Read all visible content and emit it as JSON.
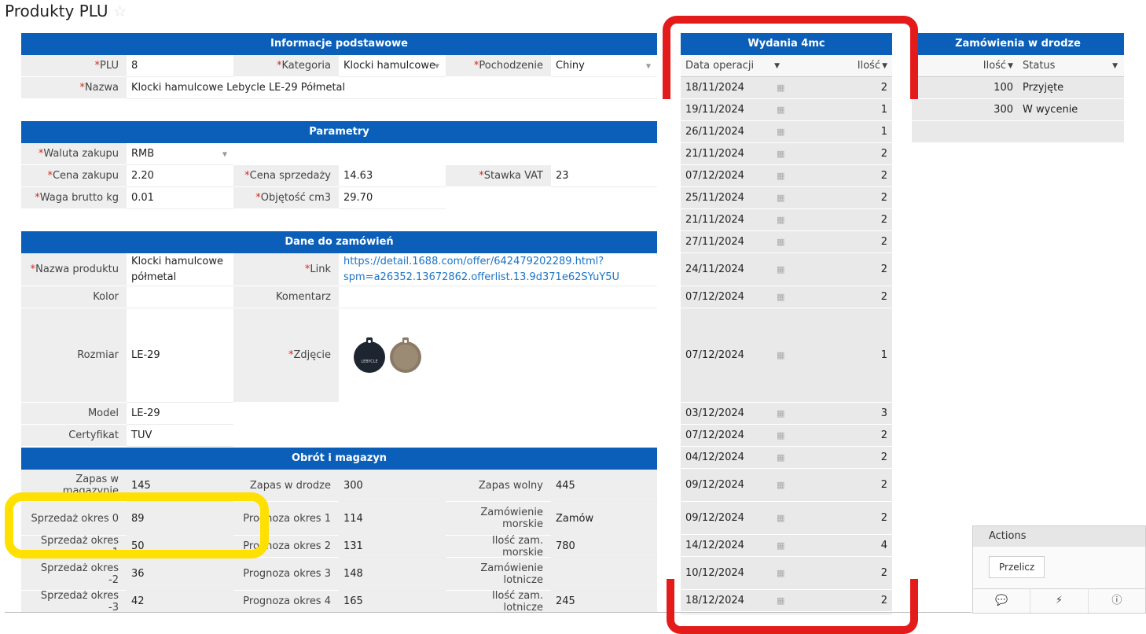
{
  "page": {
    "title": "Produkty PLU",
    "star_icon": "star-icon"
  },
  "info": {
    "header": "Informacje podstawowe",
    "plu_label": "PLU",
    "plu_value": "8",
    "kategoria_label": "Kategoria",
    "kategoria_value": "Klocki hamulcowe",
    "pochodzenie_label": "Pochodzenie",
    "pochodzenie_value": "Chiny",
    "nazwa_label": "Nazwa",
    "nazwa_value": "Klocki hamulcowe Lebycle LE-29 Półmetal"
  },
  "params": {
    "header": "Parametry",
    "waluta_label": "Waluta zakupu",
    "waluta_value": "RMB",
    "cena_zakupu_label": "Cena zakupu",
    "cena_zakupu_value": "2.20",
    "cena_sprzedazy_label": "Cena sprzedaży",
    "cena_sprzedazy_value": "14.63",
    "vat_label": "Stawka VAT",
    "vat_value": "23",
    "waga_label": "Waga brutto kg",
    "waga_value": "0.01",
    "objetosc_label": "Objętość cm3",
    "objetosc_value": "29.70"
  },
  "orders_data": {
    "header": "Dane do zamówień",
    "nazwa_produktu_label": "Nazwa produktu",
    "nazwa_produktu_l1": "Klocki hamulcowe",
    "nazwa_produktu_l2": "półmetal",
    "link_label": "Link",
    "link_l1": "https://detail.1688.com/offer/642479202289.html?",
    "link_l2": "spm=a26352.13672862.offerlist.13.9d371e62SYuY5U",
    "kolor_label": "Kolor",
    "kolor_value": "",
    "komentarz_label": "Komentarz",
    "komentarz_value": "",
    "rozmiar_label": "Rozmiar",
    "rozmiar_value": "LE-29",
    "zdjecie_label": "Zdjęcie",
    "logo_text": "LEBYCLE",
    "model_label": "Model",
    "model_value": "LE-29",
    "certyfikat_label": "Certyfikat",
    "certyfikat_value": "TUV"
  },
  "stock": {
    "header": "Obrót i magazyn",
    "rows": [
      {
        "l1": "Zapas w magazynie",
        "v1": "145",
        "l2": "Zapas w drodze",
        "v2": "300",
        "l3": "Zapas wolny",
        "v3": "445"
      },
      {
        "l1": "Sprzedaż okres 0",
        "v1": "89",
        "l2": "Prognoza okres 1",
        "v2": "114",
        "l3": "Zamówienie morskie",
        "v3": "Zamów"
      },
      {
        "l1": "Sprzedaż okres -1",
        "v1": "50",
        "l2": "Prognoza okres 2",
        "v2": "131",
        "l3": "Ilość zam. morskie",
        "v3": "780"
      },
      {
        "l1": "Sprzedaż okres -2",
        "v1": "36",
        "l2": "Prognoza okres 3",
        "v2": "148",
        "l3": "Zamówienie lotnicze",
        "v3": ""
      },
      {
        "l1": "Sprzedaż okres -3",
        "v1": "42",
        "l2": "Prognoza okres 4",
        "v2": "165",
        "l3": "Ilość zam. lotnicze",
        "v3": "245"
      }
    ]
  },
  "wydania": {
    "header": "Wydania 4mc",
    "col_date": "Data operacji",
    "col_qty": "Ilość",
    "rows": [
      {
        "date": "18/11/2024",
        "qty": "2"
      },
      {
        "date": "19/11/2024",
        "qty": "1"
      },
      {
        "date": "26/11/2024",
        "qty": "1"
      },
      {
        "date": "21/11/2024",
        "qty": "2"
      },
      {
        "date": "07/12/2024",
        "qty": "2"
      },
      {
        "date": "25/11/2024",
        "qty": "2"
      },
      {
        "date": "21/11/2024",
        "qty": "2"
      },
      {
        "date": "27/11/2024",
        "qty": "2"
      },
      {
        "date": "24/11/2024",
        "qty": "2"
      },
      {
        "date": "07/12/2024",
        "qty": "2"
      },
      {
        "date": "07/12/2024",
        "qty": "1"
      },
      {
        "date": "03/12/2024",
        "qty": "3"
      },
      {
        "date": "07/12/2024",
        "qty": "2"
      },
      {
        "date": "04/12/2024",
        "qty": "2"
      },
      {
        "date": "09/12/2024",
        "qty": "2"
      },
      {
        "date": "09/12/2024",
        "qty": "2"
      },
      {
        "date": "14/12/2024",
        "qty": "4"
      },
      {
        "date": "10/12/2024",
        "qty": "2"
      },
      {
        "date": "18/12/2024",
        "qty": "2"
      }
    ]
  },
  "zamowienia": {
    "header": "Zamówienia w drodze",
    "col_qty": "Ilość",
    "col_status": "Status",
    "rows": [
      {
        "qty": "100",
        "status": "Przyjęte"
      },
      {
        "qty": "300",
        "status": "W wycenie"
      }
    ]
  },
  "actions": {
    "title": "Actions",
    "button": "Przelicz",
    "icons": [
      "comment-icon",
      "bolt-icon",
      "info-icon"
    ]
  },
  "colors": {
    "header_blue": "#0b5fb8",
    "required_red": "#d9261c",
    "annotation_red": "#e41b1b",
    "annotation_yellow": "#ffe000"
  }
}
